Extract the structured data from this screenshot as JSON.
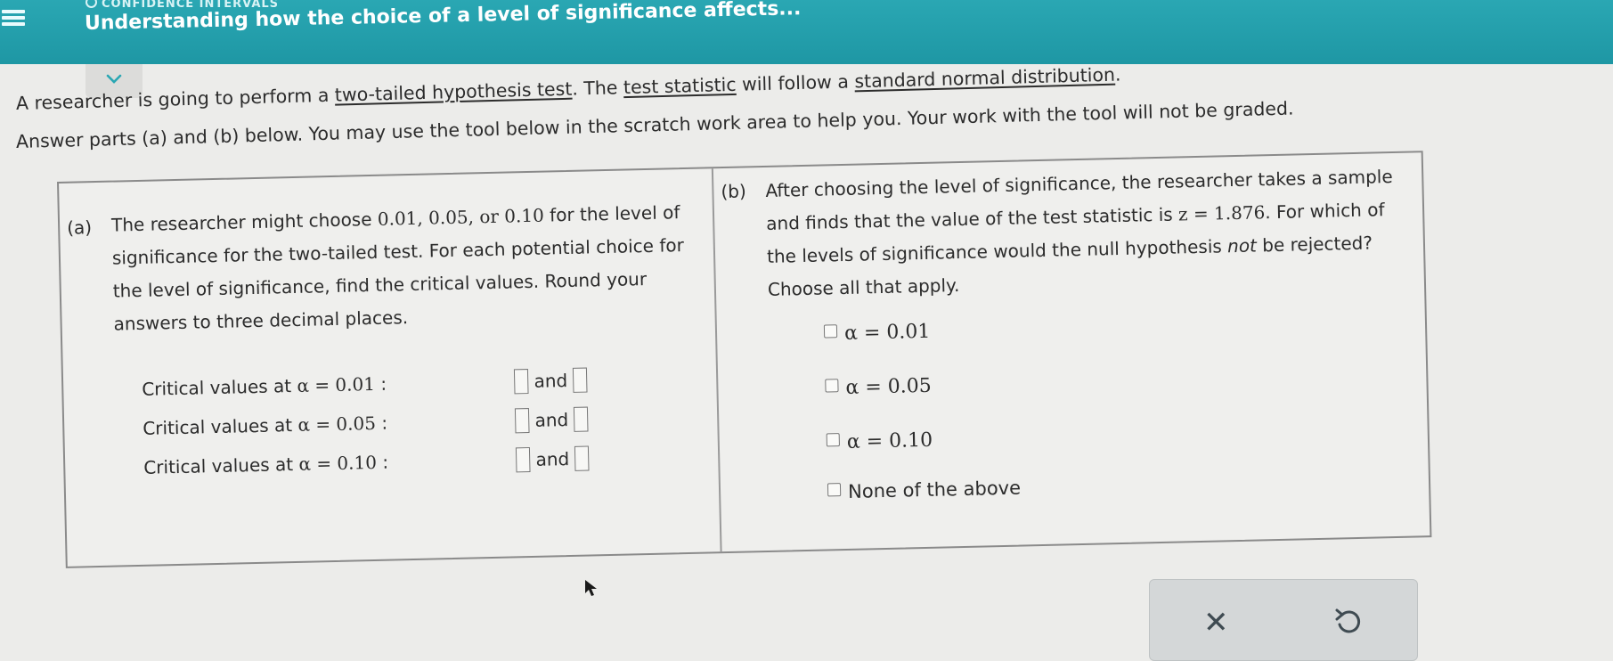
{
  "header": {
    "topic_sub": "CONFIDENCE INTERVALS",
    "title": "Understanding how the choice of a level of significance affects..."
  },
  "intro": {
    "line1_prefix": "A researcher is going to perform a ",
    "link_two_tailed": "two-tailed hypothesis test",
    "line1_mid": ". The ",
    "link_test_statistic": "test statistic",
    "line1_mid2": " will follow a ",
    "link_standard_normal": "standard normal distribution",
    "line1_end": ".",
    "line2": "A researcher is going to perform a two-tailed hypothesis test. The test statistic will follow a standard normal distribution.",
    "line3": "Answer parts (a) and (b) below. You may use the tool below in the scratch work area to help you. Your work with the tool will not be graded."
  },
  "part_a": {
    "label": "(a)",
    "text_1": "The researcher might choose ",
    "text_values": "0.01, 0.05, or 0.10",
    "text_2": " for the level of significance for the two-tailed test. For each potential choice for the level of significance, find the critical values. Round your answers to three decimal places.",
    "rows": [
      {
        "label": "Critical values at ",
        "alpha": "α = 0.01",
        "colon": " :",
        "and": "and"
      },
      {
        "label": "Critical values at ",
        "alpha": "α = 0.05",
        "colon": " :",
        "and": "and"
      },
      {
        "label": "Critical values at ",
        "alpha": "α = 0.10",
        "colon": " :",
        "and": "and"
      }
    ]
  },
  "part_b": {
    "label": "(b)",
    "text_1": "After choosing the level of significance, the researcher takes a sample and finds that the value of the test statistic is ",
    "z_value": "z = 1.876",
    "text_2": ". For which of the levels of significance would the null hypothesis ",
    "text_not": "not",
    "text_3": " be rejected? Choose all that apply.",
    "options": [
      "α = 0.01",
      "α = 0.05",
      "α = 0.10",
      "None of the above"
    ]
  },
  "actions": {
    "clear_symbol": "✕"
  }
}
